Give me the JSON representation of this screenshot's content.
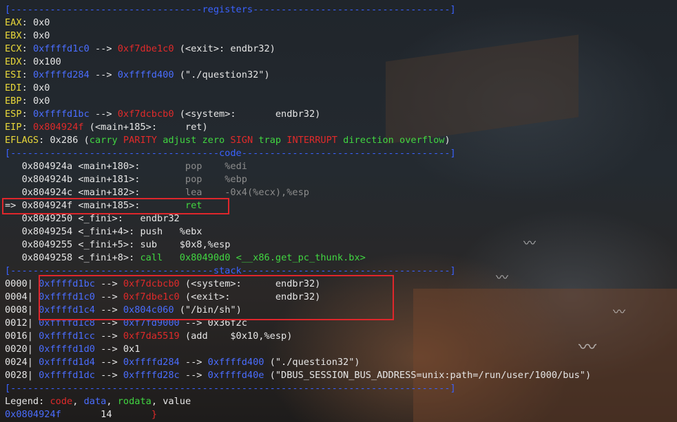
{
  "separators": {
    "registers": "[----------------------------------registers-----------------------------------]",
    "code": "[-------------------------------------code-------------------------------------]",
    "stack": "[------------------------------------stack-------------------------------------]",
    "end": "[------------------------------------------------------------------------------]"
  },
  "registers": {
    "eax": {
      "name": "EAX",
      "value": "0x0"
    },
    "ebx": {
      "name": "EBX",
      "value": "0x0"
    },
    "ecx": {
      "name": "ECX",
      "ptr": "0xffffd1c0",
      "arrow": " --> ",
      "target": "0xf7dbe1c0",
      "desc": " (<exit>: endbr32)"
    },
    "edx": {
      "name": "EDX",
      "value": "0x100"
    },
    "esi": {
      "name": "ESI",
      "ptr": "0xffffd284",
      "arrow": " --> ",
      "target": "0xffffd400",
      "desc": " (\"./question32\")"
    },
    "edi": {
      "name": "EDI",
      "value": "0x0"
    },
    "ebp": {
      "name": "EBP",
      "value": "0x0"
    },
    "esp": {
      "name": "ESP",
      "ptr": "0xffffd1bc",
      "arrow": " --> ",
      "target": "0xf7dcbcb0",
      "desc": " (<system>:       endbr32)"
    },
    "eip": {
      "name": "EIP",
      "ptr": "0x804924f",
      "desc": " (<main+185>:     ret)"
    },
    "eflags": {
      "name": "EFLAGS",
      "value": "0x286 (",
      "flags": [
        "carry",
        "PARITY",
        "adjust",
        "zero",
        "SIGN",
        "trap",
        "INTERRUPT",
        "direction",
        "overflow"
      ],
      "close": ")"
    }
  },
  "code": [
    {
      "prefix": "   ",
      "addr": "0x804924a",
      "sym": " <main+180>:        ",
      "op": "pop",
      "args": "    %edi"
    },
    {
      "prefix": "   ",
      "addr": "0x804924b",
      "sym": " <main+181>:        ",
      "op": "pop",
      "args": "    %ebp"
    },
    {
      "prefix": "   ",
      "addr": "0x804924c",
      "sym": " <main+182>:        ",
      "op": "lea",
      "args": "    -0x4(%ecx),%esp"
    },
    {
      "prefix": "=> ",
      "addr": "0x804924f",
      "sym": " <main+185>:        ",
      "op": "ret",
      "args": ""
    },
    {
      "prefix": "   ",
      "addr": "0x8049250",
      "sym": " <_fini>:   ",
      "op": "endbr32",
      "args": ""
    },
    {
      "prefix": "   ",
      "addr": "0x8049254",
      "sym": " <_fini+4>: ",
      "op": "push",
      "args": "   %ebx"
    },
    {
      "prefix": "   ",
      "addr": "0x8049255",
      "sym": " <_fini+5>: ",
      "op": "sub",
      "args": "    $0x8,%esp"
    },
    {
      "prefix": "   ",
      "addr": "0x8049258",
      "sym": " <_fini+8>: ",
      "op": "call",
      "args": "   0x80490d0 <__x86.get_pc_thunk.bx>"
    }
  ],
  "stack": [
    {
      "off": "0000| ",
      "addr": "0xffffd1bc",
      "arrow": " --> ",
      "target": "0xf7dcbcb0",
      "rest": " (<system>:      endbr32)"
    },
    {
      "off": "0004| ",
      "addr": "0xffffd1c0",
      "arrow": " --> ",
      "target": "0xf7dbe1c0",
      "rest": " (<exit>:        endbr32)"
    },
    {
      "off": "0008| ",
      "addr": "0xffffd1c4",
      "arrow": " --> ",
      "target": "0x804c060",
      "rest": " (\"/bin/sh\")"
    },
    {
      "off": "0012| ",
      "addr": "0xffffd1c8",
      "arrow": " --> ",
      "target": "0xf7fd9000",
      "rest": " --> 0x36f2c"
    },
    {
      "off": "0016| ",
      "addr": "0xffffd1cc",
      "arrow": " --> ",
      "target": "0xf7da5519",
      "rest": " (add    $0x10,%esp)"
    },
    {
      "off": "0020| ",
      "addr": "0xffffd1d0",
      "arrow": " --> ",
      "target": "",
      "rest": "0x1"
    },
    {
      "off": "0024| ",
      "addr": "0xffffd1d4",
      "arrow": " --> ",
      "target": "0xffffd284",
      "rest": " --> ",
      "target2": "0xffffd400",
      "rest2": " (\"./question32\")"
    },
    {
      "off": "0028| ",
      "addr": "0xffffd1dc",
      "arrow": " --> ",
      "target": "0xffffd28c",
      "rest": " --> ",
      "target2": "0xffffd40e",
      "rest2": " (\"DBUS_SESSION_BUS_ADDRESS=unix:path=/run/user/1000/bus\")"
    }
  ],
  "legend": {
    "label": "Legend: ",
    "items": [
      "code",
      "data",
      "rodata",
      "value"
    ]
  },
  "status": {
    "addr": "0x0804924f",
    "num": "14",
    "bracket": "}"
  },
  "colors": {
    "register": "#e8d73a",
    "address": "#4a6dff",
    "code_ptr": "#e02a2a",
    "data": "#41d641",
    "highlight_box": "#e0262b"
  }
}
